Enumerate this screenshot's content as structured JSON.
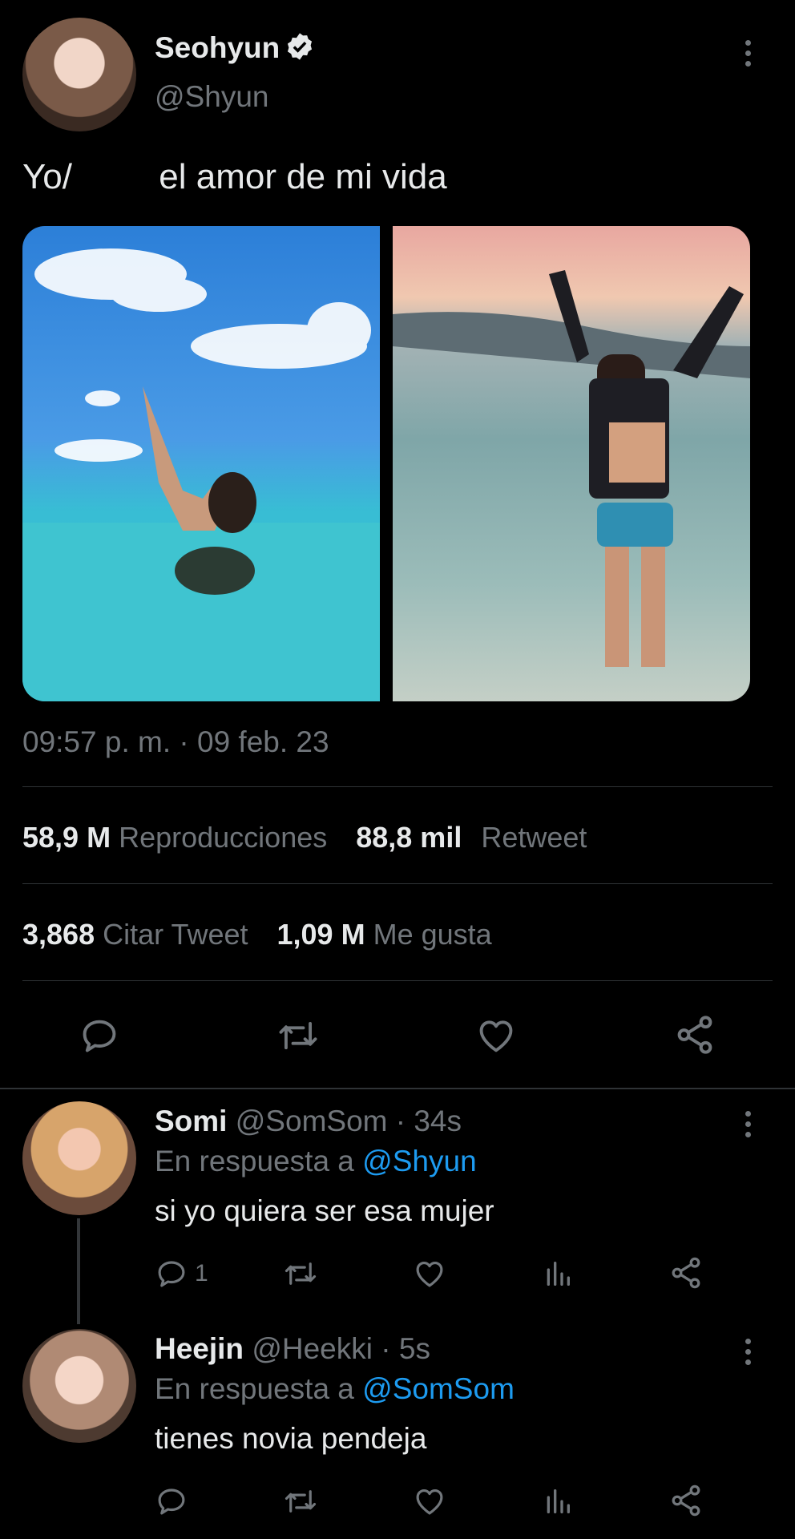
{
  "tweet": {
    "author": {
      "name": "Seohyun",
      "handle": "@Shyun",
      "verified": true
    },
    "text_part1": "Yo/",
    "text_part2": "el amor de mi vida",
    "timestamp": "09:57 p. m. · 09 feb. 23",
    "stats": {
      "views_count": "58,9 M",
      "views_label": "Reproducciones",
      "retweets_count": "88,8 mil",
      "retweets_label": "Retweet",
      "quotes_count": "3,868",
      "quotes_label": "Citar Tweet",
      "likes_count": "1,09 M",
      "likes_label": "Me gusta"
    },
    "actions": [
      "reply-icon",
      "retweet-icon",
      "like-icon",
      "share-icon"
    ]
  },
  "replies": [
    {
      "name": "Somi",
      "handle": "@SomSom",
      "time": "· 34s",
      "reply_prefix": "En respuesta a",
      "reply_to": "@Shyun",
      "text": "si yo quiera ser esa mujer",
      "reply_count": "1"
    },
    {
      "name": "Heejin",
      "handle": "@Heekki",
      "time": "· 5s",
      "reply_prefix": "En respuesta a",
      "reply_to": "@SomSom",
      "text": "tienes novia pendeja",
      "reply_count": ""
    }
  ],
  "colors": {
    "background": "#000000",
    "text": "#e7e9ea",
    "muted": "#71767b",
    "accent": "#1d9bf0",
    "divider": "#2f3336"
  }
}
